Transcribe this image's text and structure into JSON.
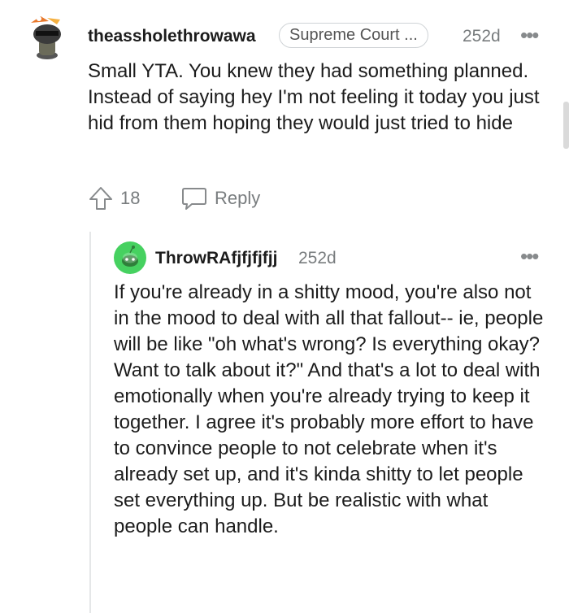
{
  "comment": {
    "username": "theassholethrowawa",
    "flair": "Supreme Court ...",
    "time": "252d",
    "more": "•••",
    "body": "Small YTA. You knew they had something planned. Instead of saying hey I'm not feeling it today you just hid from them hoping they would just tried to hide",
    "upvotes": "18",
    "reply_label": "Reply"
  },
  "reply": {
    "username": "ThrowRAfjfjfjfjj",
    "time": "252d",
    "more": "•••",
    "body": "If you're already in a shitty mood, you're also not in the mood to deal with all that fallout-- ie, people will be like \"oh what's wrong? Is everything okay? Want to talk about it?\" And that's a lot to deal with emotionally when you're already trying to keep it together. I agree it's probably more effort to have to convince people to not celebrate when it's already set up, and it's kinda shitty to let people set everything up. But be realistic with what people can handle."
  }
}
